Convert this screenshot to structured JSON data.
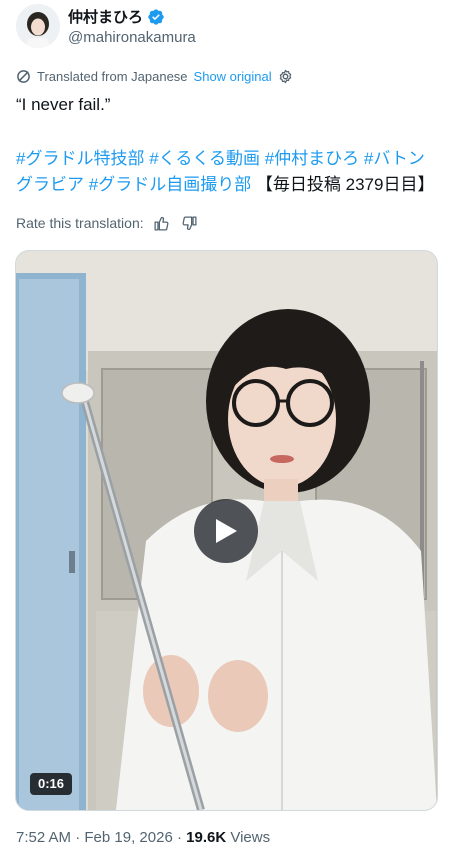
{
  "author": {
    "display_name": "仲村まひろ",
    "handle": "@mahironakamura",
    "verified_color": "#1d9bf0"
  },
  "translation": {
    "translated_label": "Translated from Japanese",
    "show_original_label": "Show original",
    "rate_label": "Rate this translation:",
    "icons": [
      "translate-icon",
      "gear-icon",
      "thumbs-up-icon",
      "thumbs-down-icon"
    ]
  },
  "tweet": {
    "text": "“I never fail.”",
    "hashtags_line1": [
      {
        "text": "#グラドル特技部",
        "is_tag": true
      },
      {
        "text": " ",
        "is_tag": false
      },
      {
        "text": "#くるくる動画",
        "is_tag": true
      },
      {
        "text": " ",
        "is_tag": false
      },
      {
        "text": "#仲村まひろ",
        "is_tag": true
      },
      {
        "text": " ",
        "is_tag": false
      },
      {
        "text": "#バトン",
        "is_tag": true
      }
    ],
    "hashtags_line2": [
      {
        "text": "グラビア",
        "is_tag": true
      },
      {
        "text": " ",
        "is_tag": false
      },
      {
        "text": "#グラドル自画撮り部",
        "is_tag": true
      },
      {
        "text": " 【毎日投稿 2379日目】",
        "is_tag": false
      }
    ]
  },
  "media": {
    "duration": "0:16",
    "play_icon": "play-icon"
  },
  "meta": {
    "time": "7:52 AM",
    "separator": " · ",
    "date": "Feb 19, 2026",
    "views_count": "19.6K",
    "views_label": " Views"
  },
  "colors": {
    "link": "#1d9bf0",
    "secondary_text": "#536471",
    "primary_text": "#0f1419"
  }
}
